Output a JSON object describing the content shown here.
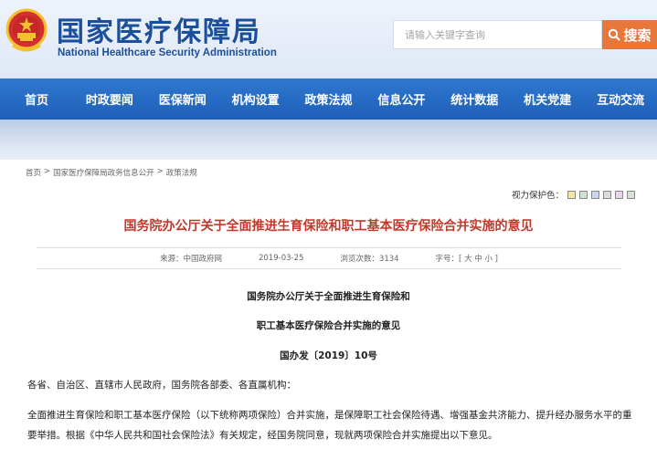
{
  "header": {
    "title_cn": "国家医疗保障局",
    "title_en": "National Healthcare Security Administration",
    "search_placeholder": "请输入关键字查询",
    "search_button": "搜索"
  },
  "nav": {
    "items": [
      "首页",
      "时政要闻",
      "医保新闻",
      "机构设置",
      "政策法规",
      "信息公开",
      "统计数据",
      "机关党建",
      "互动交流"
    ]
  },
  "breadcrumb": [
    "首页",
    ">",
    "国家医疗保障局政务信息公开",
    ">",
    "政策法规"
  ],
  "eye_care": {
    "label": "视力保护色：",
    "colors": [
      "#f5e6a6",
      "#cfe3c8",
      "#c9d7ee",
      "#dcdcdc",
      "#e7d3ea",
      "#d8e2d0"
    ]
  },
  "article": {
    "title": "国务院办公厅关于全面推进生育保险和职工基本医疗保险合并实施的意见",
    "meta": {
      "source": "来源：中国政府网",
      "date": "2019-03-25",
      "views": "浏览次数：3134",
      "font_size": "字号：[ 大 中 小 ]"
    },
    "body_title_line1": "国务院办公厅关于全面推进生育保险和",
    "body_title_line2": "职工基本医疗保险合并实施的意见",
    "doc_number": "国办发〔2019〕10号",
    "recipients": "各省、自治区、直辖市人民政府，国务院各部委、各直属机构：",
    "paragraph": "全面推进生育保险和职工基本医疗保险（以下统称两项保险）合并实施，是保障职工社会保险待遇、增强基金共济能力、提升经办服务水平的重要举措。根据《中华人民共和国社会保险法》有关规定，经国务院同意，现就两项保险合并实施提出以下意见。"
  }
}
